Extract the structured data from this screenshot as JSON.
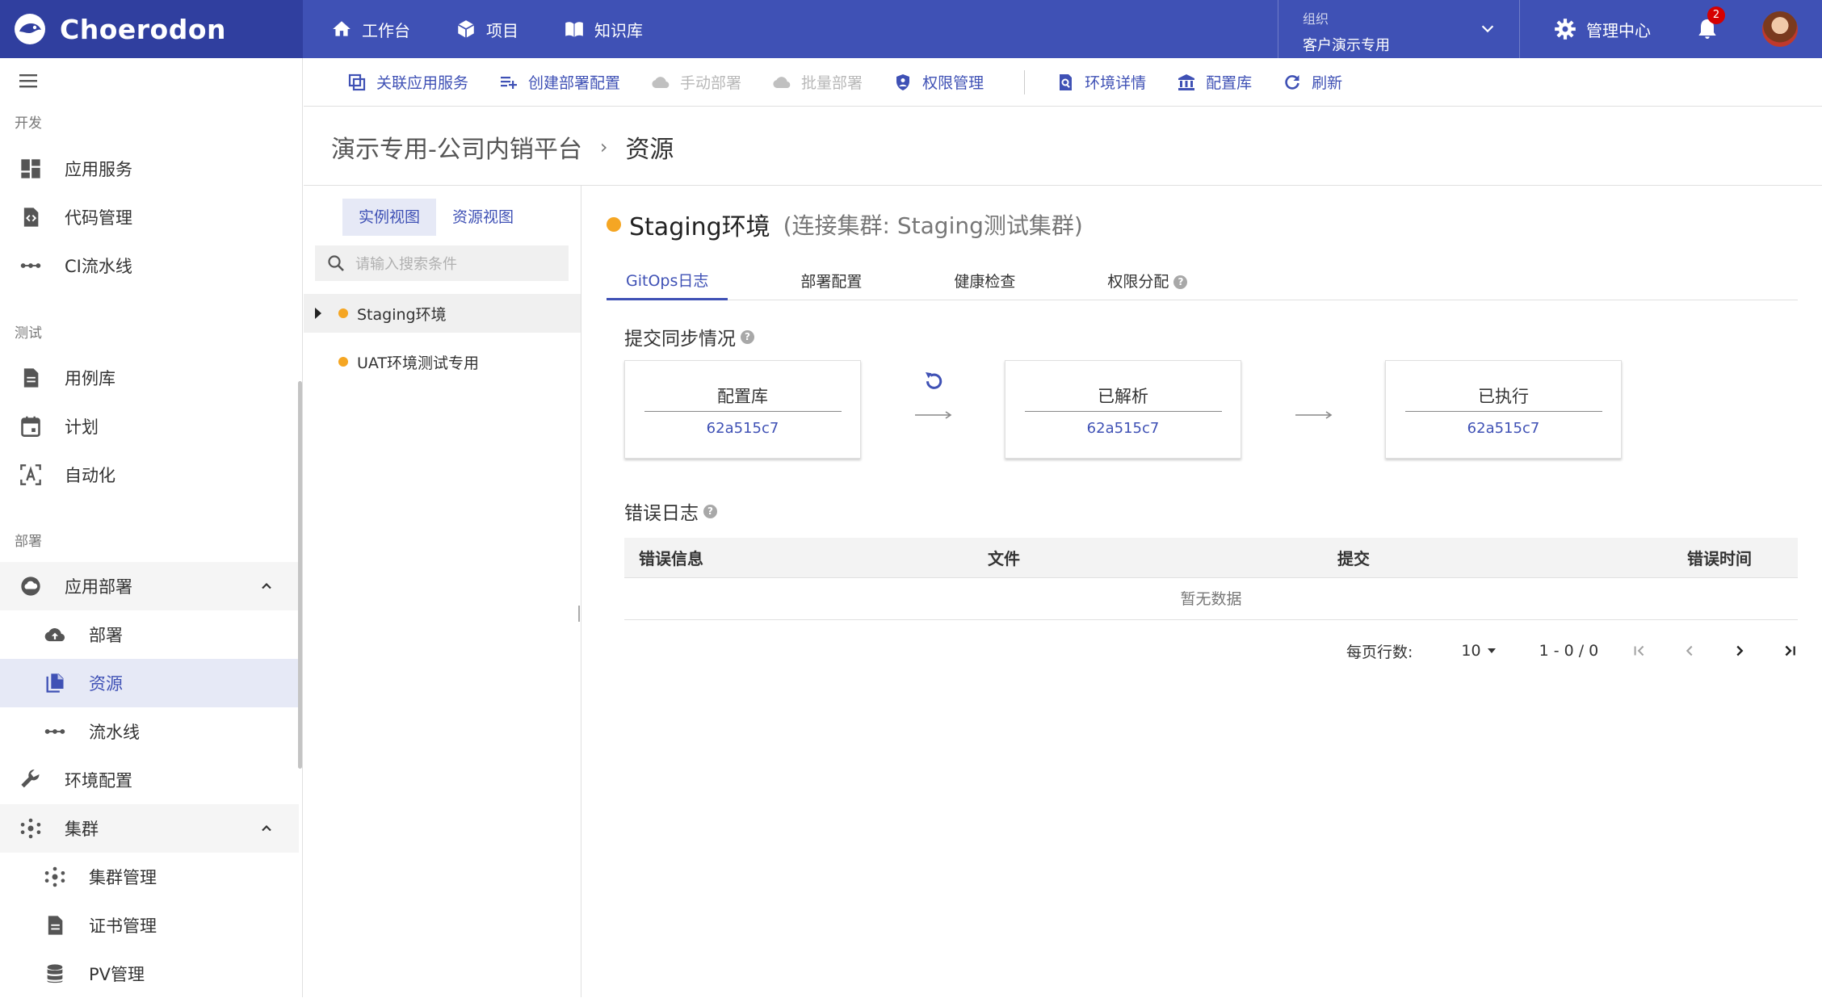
{
  "app": {
    "name": "Choerodon"
  },
  "nav": [
    {
      "label": "工作台",
      "icon": "home-icon"
    },
    {
      "label": "项目",
      "icon": "cube-icon"
    },
    {
      "label": "知识库",
      "icon": "book-icon"
    }
  ],
  "org": {
    "label": "组织",
    "value": "客户演示专用"
  },
  "admin": {
    "label": "管理中心"
  },
  "notifications": {
    "count": "2"
  },
  "sidebar": {
    "groups": {
      "dev": "开发",
      "test": "测试",
      "deploy": "部署"
    },
    "items": {
      "app_service": "应用服务",
      "code_mgmt": "代码管理",
      "ci": "CI流水线",
      "case_lib": "用例库",
      "plan": "计划",
      "automation": "自动化",
      "app_deploy": "应用部署",
      "deploy": "部署",
      "resource": "资源",
      "pipeline": "流水线",
      "env_config": "环境配置",
      "cluster": "集群",
      "cluster_mgmt": "集群管理",
      "cert_mgmt": "证书管理",
      "pv_mgmt": "PV管理"
    }
  },
  "toolbar": {
    "link_service": "关联应用服务",
    "create_deploy_config": "创建部署配置",
    "manual_deploy": "手动部署",
    "batch_deploy": "批量部署",
    "permission_mgmt": "权限管理",
    "env_details": "环境详情",
    "config_repo": "配置库",
    "refresh": "刷新"
  },
  "breadcrumb": {
    "project": "演示专用-公司内销平台",
    "separator": "›",
    "current": "资源"
  },
  "left_panel": {
    "tabs": [
      "实例视图",
      "资源视图"
    ],
    "search_placeholder": "请输入搜索条件",
    "envs": [
      "Staging环境",
      "UAT环境测试专用"
    ]
  },
  "env": {
    "name": "Staging环境",
    "cluster": "(连接集群: Staging测试集群)",
    "status_color": "#f5a623"
  },
  "tabs": [
    "GitOps日志",
    "部署配置",
    "健康检查",
    "权限分配"
  ],
  "sync": {
    "title": "提交同步情况",
    "cards": [
      {
        "title": "配置库",
        "value": "62a515c7"
      },
      {
        "title": "已解析",
        "value": "62a515c7"
      },
      {
        "title": "已执行",
        "value": "62a515c7"
      }
    ]
  },
  "error_log": {
    "title": "错误日志",
    "columns": [
      "错误信息",
      "文件",
      "提交",
      "错误时间"
    ],
    "empty": "暂无数据"
  },
  "pagination": {
    "rows_label": "每页行数:",
    "page_size": "10",
    "range": "1 - 0 / 0"
  },
  "colors": {
    "primary": "#3f51b5",
    "logo_bg": "#303f9f",
    "status": "#f5a623"
  }
}
